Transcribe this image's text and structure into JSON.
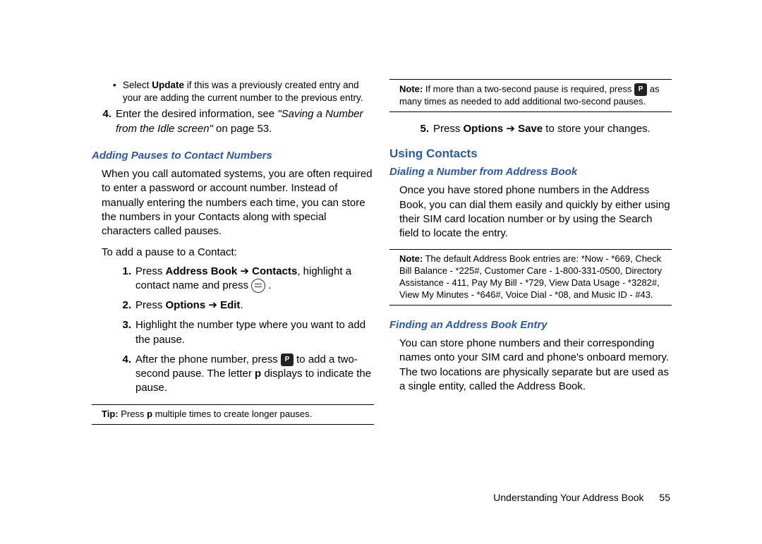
{
  "leftColumn": {
    "bullet": {
      "pre": "Select ",
      "bold": "Update",
      "post": " if this was a previously created entry and your are adding the current number to the previous entry."
    },
    "step4": {
      "num": "4.",
      "pre": "Enter the desired information, see ",
      "italic": "\"Saving a Number from the Idle screen\"",
      "post": " on page 53."
    },
    "heading1": "Adding Pauses to Contact Numbers",
    "para1": "When you call automated systems, you are often required to enter a password or account number. Instead of manually entering the numbers each time, you can store the numbers in your Contacts along with special characters called pauses.",
    "para2": "To add a pause to a Contact:",
    "list": {
      "s1": {
        "num": "1.",
        "pre": "Press ",
        "b1": "Address Book",
        "arrow1": " ➔ ",
        "b2": "Contacts",
        "mid": ", highlight a contact name and press ",
        "iconName": "center-select-icon",
        "post": " ."
      },
      "s2": {
        "num": "2.",
        "pre": "Press ",
        "b1": "Options",
        "arrow1": " ➔ ",
        "b2": "Edit",
        "post": "."
      },
      "s3": {
        "num": "3.",
        "txt": "Highlight the number type where you want to add the pause."
      },
      "s4": {
        "num": "4.",
        "pre": "After the phone number, press ",
        "iconName": "pause-key-icon",
        "mid": " to add a two-second pause. The letter ",
        "bold": "p",
        "post": " displays to indicate the pause."
      }
    },
    "tip": {
      "label": "Tip:",
      "pre": " Press ",
      "bold": "p",
      "post": " multiple times to create longer pauses."
    }
  },
  "rightColumn": {
    "note1": {
      "label": "Note:",
      "pre": " If more than a two-second pause is required, press ",
      "iconName": "pause-key-icon",
      "post": " as many times as needed to add additional two-second pauses."
    },
    "step5": {
      "num": "5.",
      "pre": "Press ",
      "b1": "Options",
      "arrow1": " ➔ ",
      "b2": "Save",
      "post": " to store your changes."
    },
    "heading2": "Using Contacts",
    "subheading1": "Dialing a Number from Address Book",
    "para3": "Once you have stored phone numbers in the Address Book, you can dial them easily and quickly by either using their SIM card location number or by using the Search field to locate the entry.",
    "note2": {
      "label": "Note:",
      "txt": " The default Address Book entries are: *Now - *669, Check Bill Balance - *225#, Customer Care - 1-800-331-0500, Directory Assistance - 411, Pay My Bill - *729, View Data Usage - *3282#, View My Minutes - *646#, Voice Dial - *08, and Music ID - #43."
    },
    "subheading2": "Finding an Address Book Entry",
    "para4": "You can store phone numbers and their corresponding names onto your SIM card and phone's onboard memory. The two locations are physically separate but are used as a single entity, called the Address Book."
  },
  "footer": {
    "text": "Understanding Your Address Book",
    "page": "55"
  }
}
